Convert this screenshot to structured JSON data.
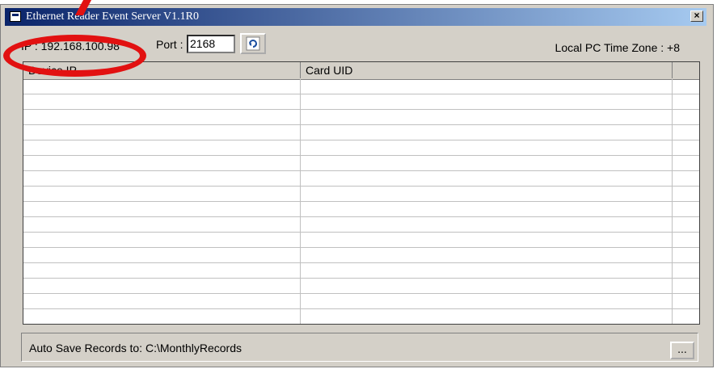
{
  "window": {
    "title": "Ethernet Reader Event Server   V1.1R0",
    "close_label": "×"
  },
  "toolbar": {
    "ip_text": "IP : 192.168.100.98",
    "port_label": "Port :",
    "port_value": "2168",
    "refresh_icon": "refresh-icon",
    "timezone_text": "Local PC Time Zone : +8"
  },
  "table": {
    "columns": [
      "Device IP",
      "Card UID",
      ""
    ],
    "row_count": 16
  },
  "status": {
    "auto_save_text": "Auto Save Records to:  C:\\MonthlyRecords",
    "browse_label": "..."
  },
  "colors": {
    "title_start": "#0a246a",
    "title_end": "#a6caf0",
    "highlight": "#e21111",
    "window_bg": "#d4d0c8"
  }
}
